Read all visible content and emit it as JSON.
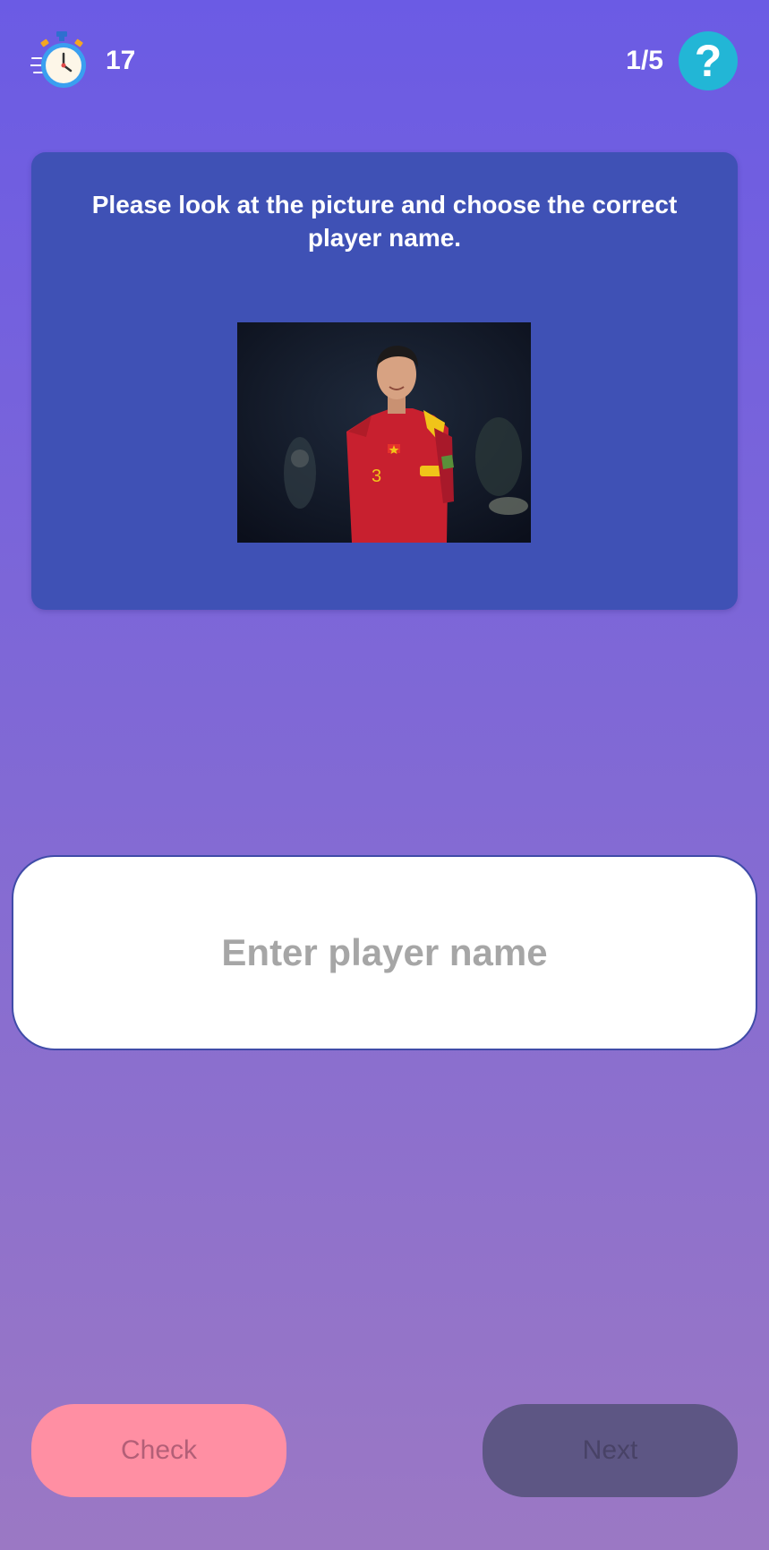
{
  "header": {
    "timer_icon": "stopwatch-icon",
    "timer_value": "17",
    "progress": "1/5",
    "help_icon": "question-mark-icon",
    "help_label": "?"
  },
  "question": {
    "text": "Please look at the picture and choose the correct player name."
  },
  "answer": {
    "placeholder": "Enter player name",
    "value": ""
  },
  "actions": {
    "check_label": "Check",
    "next_label": "Next"
  },
  "colors": {
    "card": "#3f51b5",
    "help": "#22b6d6",
    "check": "#ff8fa3",
    "next": "#5d5684"
  }
}
